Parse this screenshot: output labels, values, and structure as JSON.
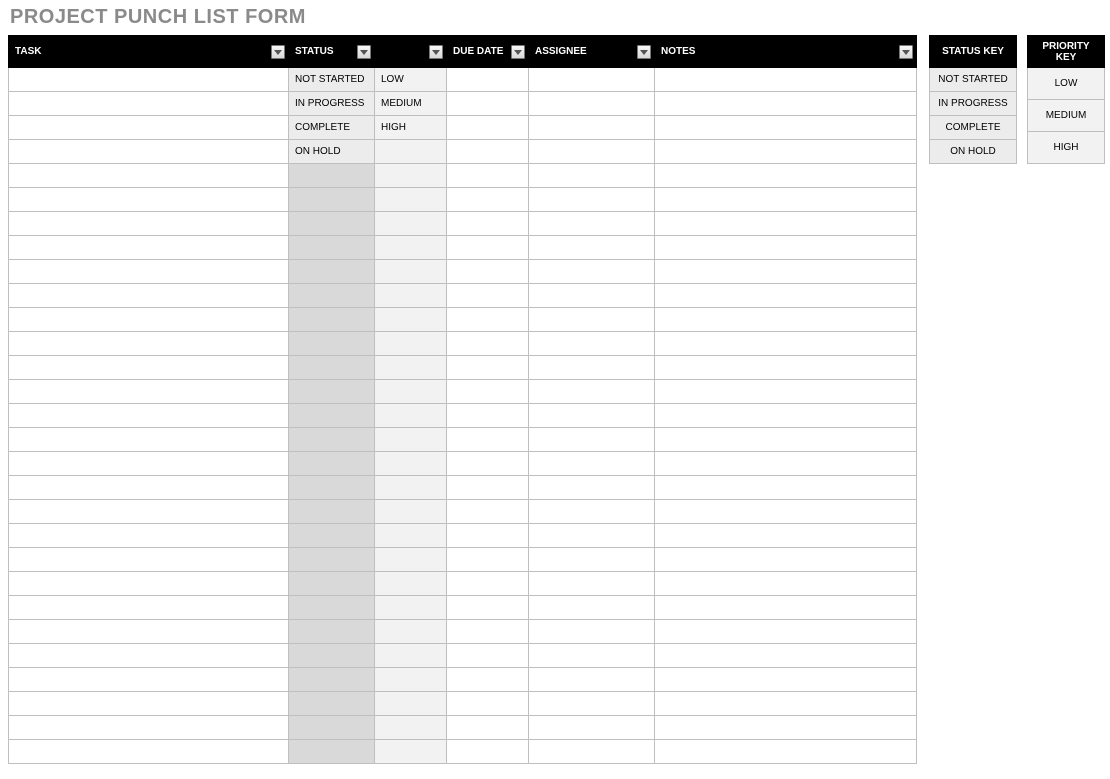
{
  "title": "PROJECT PUNCH LIST FORM",
  "columns": {
    "task": "TASK",
    "status": "STATUS",
    "priority": "",
    "due": "DUE DATE",
    "assignee": "ASSIGNEE",
    "notes": "NOTES"
  },
  "status_options": [
    "NOT STARTED",
    "IN PROGRESS",
    "COMPLETE",
    "ON HOLD"
  ],
  "priority_options": [
    "LOW",
    "MEDIUM",
    "HIGH"
  ],
  "row_count": 29,
  "keys": {
    "status_header": "STATUS KEY",
    "priority_header": "PRIORITY KEY"
  }
}
